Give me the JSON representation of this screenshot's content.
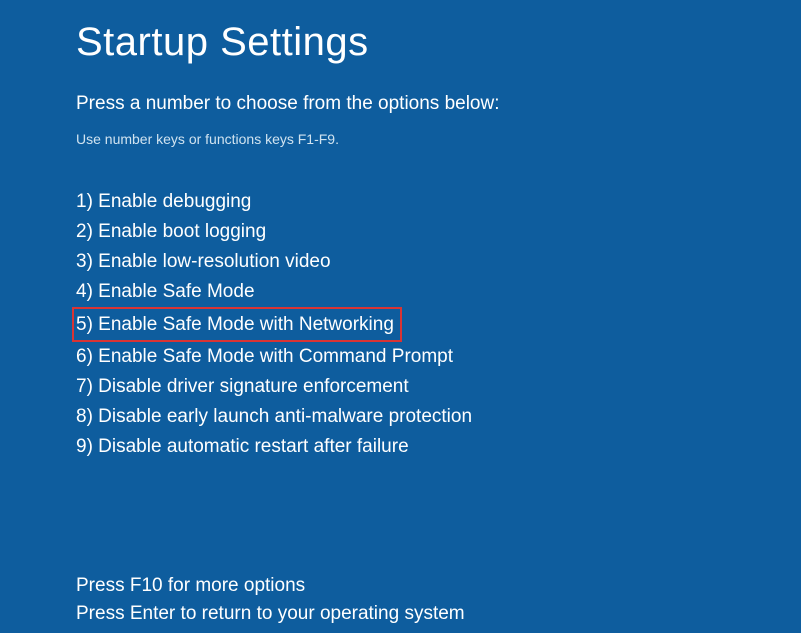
{
  "title": "Startup Settings",
  "subtitle": "Press a number to choose from the options below:",
  "hint": "Use number keys or functions keys F1-F9.",
  "options": [
    "1) Enable debugging",
    "2) Enable boot logging",
    "3) Enable low-resolution video",
    "4) Enable Safe Mode",
    "5) Enable Safe Mode with Networking",
    "6) Enable Safe Mode with Command Prompt",
    "7) Disable driver signature enforcement",
    "8) Disable early launch anti-malware protection",
    "9) Disable automatic restart after failure"
  ],
  "highlighted_index": 4,
  "footer": {
    "more_options": "Press F10 for more options",
    "return_text": "Press Enter to return to your operating system"
  }
}
